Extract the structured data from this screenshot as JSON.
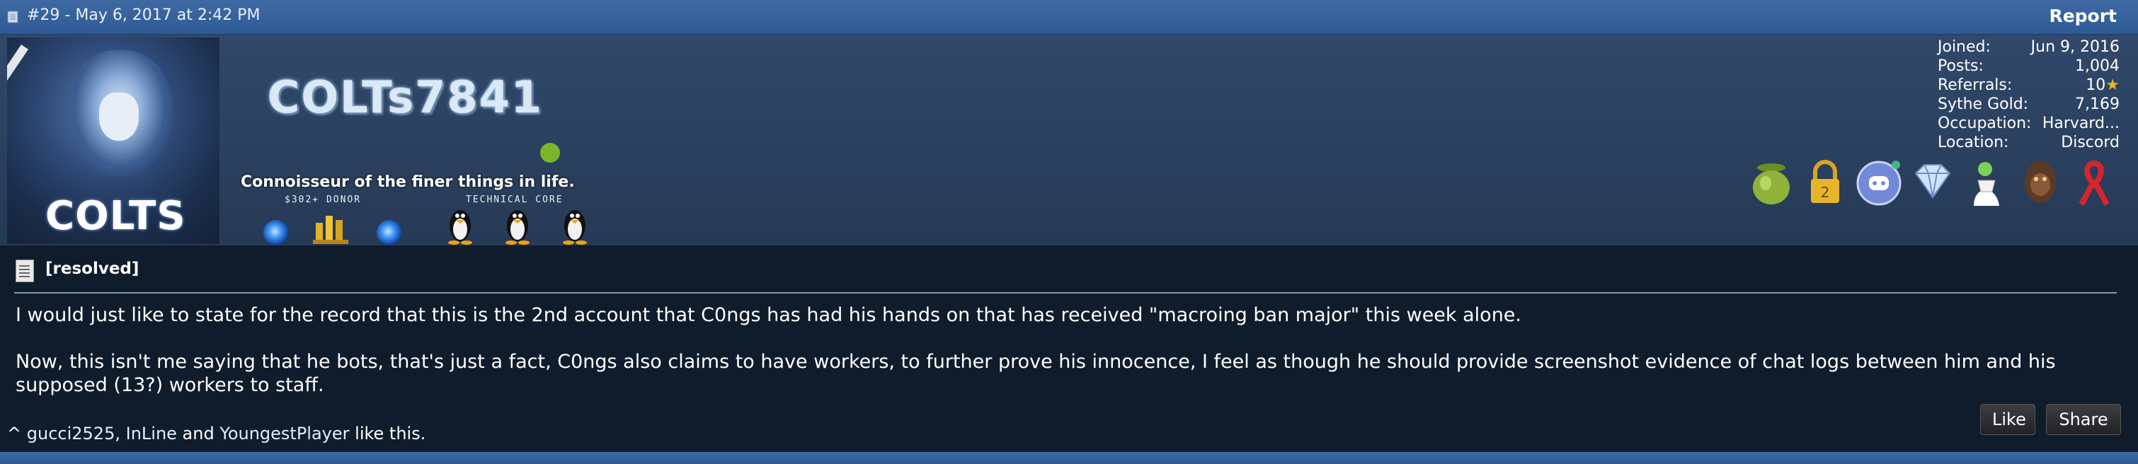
{
  "post": {
    "meta": "#29 - May 6, 2017 at 2:42 PM",
    "report_label": "Report"
  },
  "user": {
    "avatar_caption": "COLTS",
    "username": "COLTs7841",
    "title": "Connoisseur of the finer things in life.",
    "badge_groups": [
      "$302+ DONOR",
      "TECHNICAL CORE"
    ],
    "online": true
  },
  "stats": [
    {
      "label": "Joined:",
      "value": "Jun 9, 2016"
    },
    {
      "label": "Posts:",
      "value": "1,004"
    },
    {
      "label": "Referrals:",
      "value": "10"
    },
    {
      "label": "Sythe Gold:",
      "value": "7,169"
    },
    {
      "label": "Occupation:",
      "value": "Harvard..."
    },
    {
      "label": "Location:",
      "value": "Discord"
    }
  ],
  "trophies": [
    "green-pot-icon",
    "padlock-icon",
    "discord-icon",
    "diamond-icon",
    "ghost-icon",
    "gorilla-icon",
    "red-ribbon-icon"
  ],
  "content": {
    "prefix": "[resolved]",
    "paragraph1": "I would just like to state for the record that this is the 2nd account that C0ngs has had his hands on that has received \"macroing ban major\" this week alone.",
    "paragraph2": "Now, this isn't me saying that he bots, that's just a fact, C0ngs also claims to have workers, to further prove his innocence, I feel as though he should provide screenshot evidence of chat logs between him and his supposed (13?) workers to staff."
  },
  "likes": {
    "caret": "^",
    "users": [
      "gucci2525",
      "InLine",
      "YoungestPlayer"
    ],
    "connector1": ", ",
    "connector2": " and ",
    "suffix": " like this."
  },
  "actions": {
    "like_label": "Like",
    "share_label": "Share"
  },
  "colors": {
    "header": "#2e5a96",
    "profile": "#2b405f",
    "post_bg": "#0f1c2b",
    "online": "#7bb52a"
  }
}
